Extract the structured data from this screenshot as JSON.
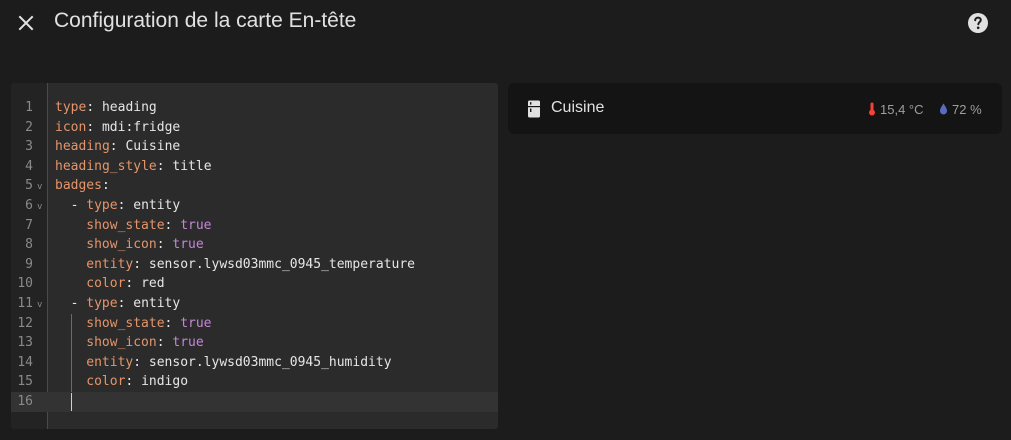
{
  "header": {
    "title": "Configuration de la carte En-tête",
    "close_icon": "close-icon",
    "help_icon": "help-circle-icon"
  },
  "editor": {
    "lines": [
      {
        "n": "1",
        "key": "type",
        "val": "heading"
      },
      {
        "n": "2",
        "key": "icon",
        "val": "mdi:fridge"
      },
      {
        "n": "3",
        "key": "heading",
        "val": "Cuisine"
      },
      {
        "n": "4",
        "key": "heading_style",
        "val": "title"
      },
      {
        "n": "5",
        "key": "badges",
        "val": ""
      },
      {
        "n": "6",
        "key": "type",
        "val": "entity"
      },
      {
        "n": "7",
        "key": "show_state",
        "val": "true"
      },
      {
        "n": "8",
        "key": "show_icon",
        "val": "true"
      },
      {
        "n": "9",
        "key": "entity",
        "val": "sensor.lywsd03mmc_0945_temperature"
      },
      {
        "n": "10",
        "key": "color",
        "val": "red"
      },
      {
        "n": "11",
        "key": "type",
        "val": "entity"
      },
      {
        "n": "12",
        "key": "show_state",
        "val": "true"
      },
      {
        "n": "13",
        "key": "show_icon",
        "val": "true"
      },
      {
        "n": "14",
        "key": "entity",
        "val": "sensor.lywsd03mmc_0945_humidity"
      },
      {
        "n": "15",
        "key": "color",
        "val": "indigo"
      },
      {
        "n": "16",
        "key": "",
        "val": ""
      }
    ]
  },
  "preview": {
    "icon": "fridge-icon",
    "title": "Cuisine",
    "badges": [
      {
        "icon": "thermometer-icon",
        "value": "15,4 °C",
        "color": "#f44336"
      },
      {
        "icon": "water-drop-icon",
        "value": "72 %",
        "color": "#3f51b5"
      }
    ]
  },
  "colors": {
    "key": "#e5956b",
    "boolean": "#c586d8",
    "background": "#1c1c1c"
  }
}
